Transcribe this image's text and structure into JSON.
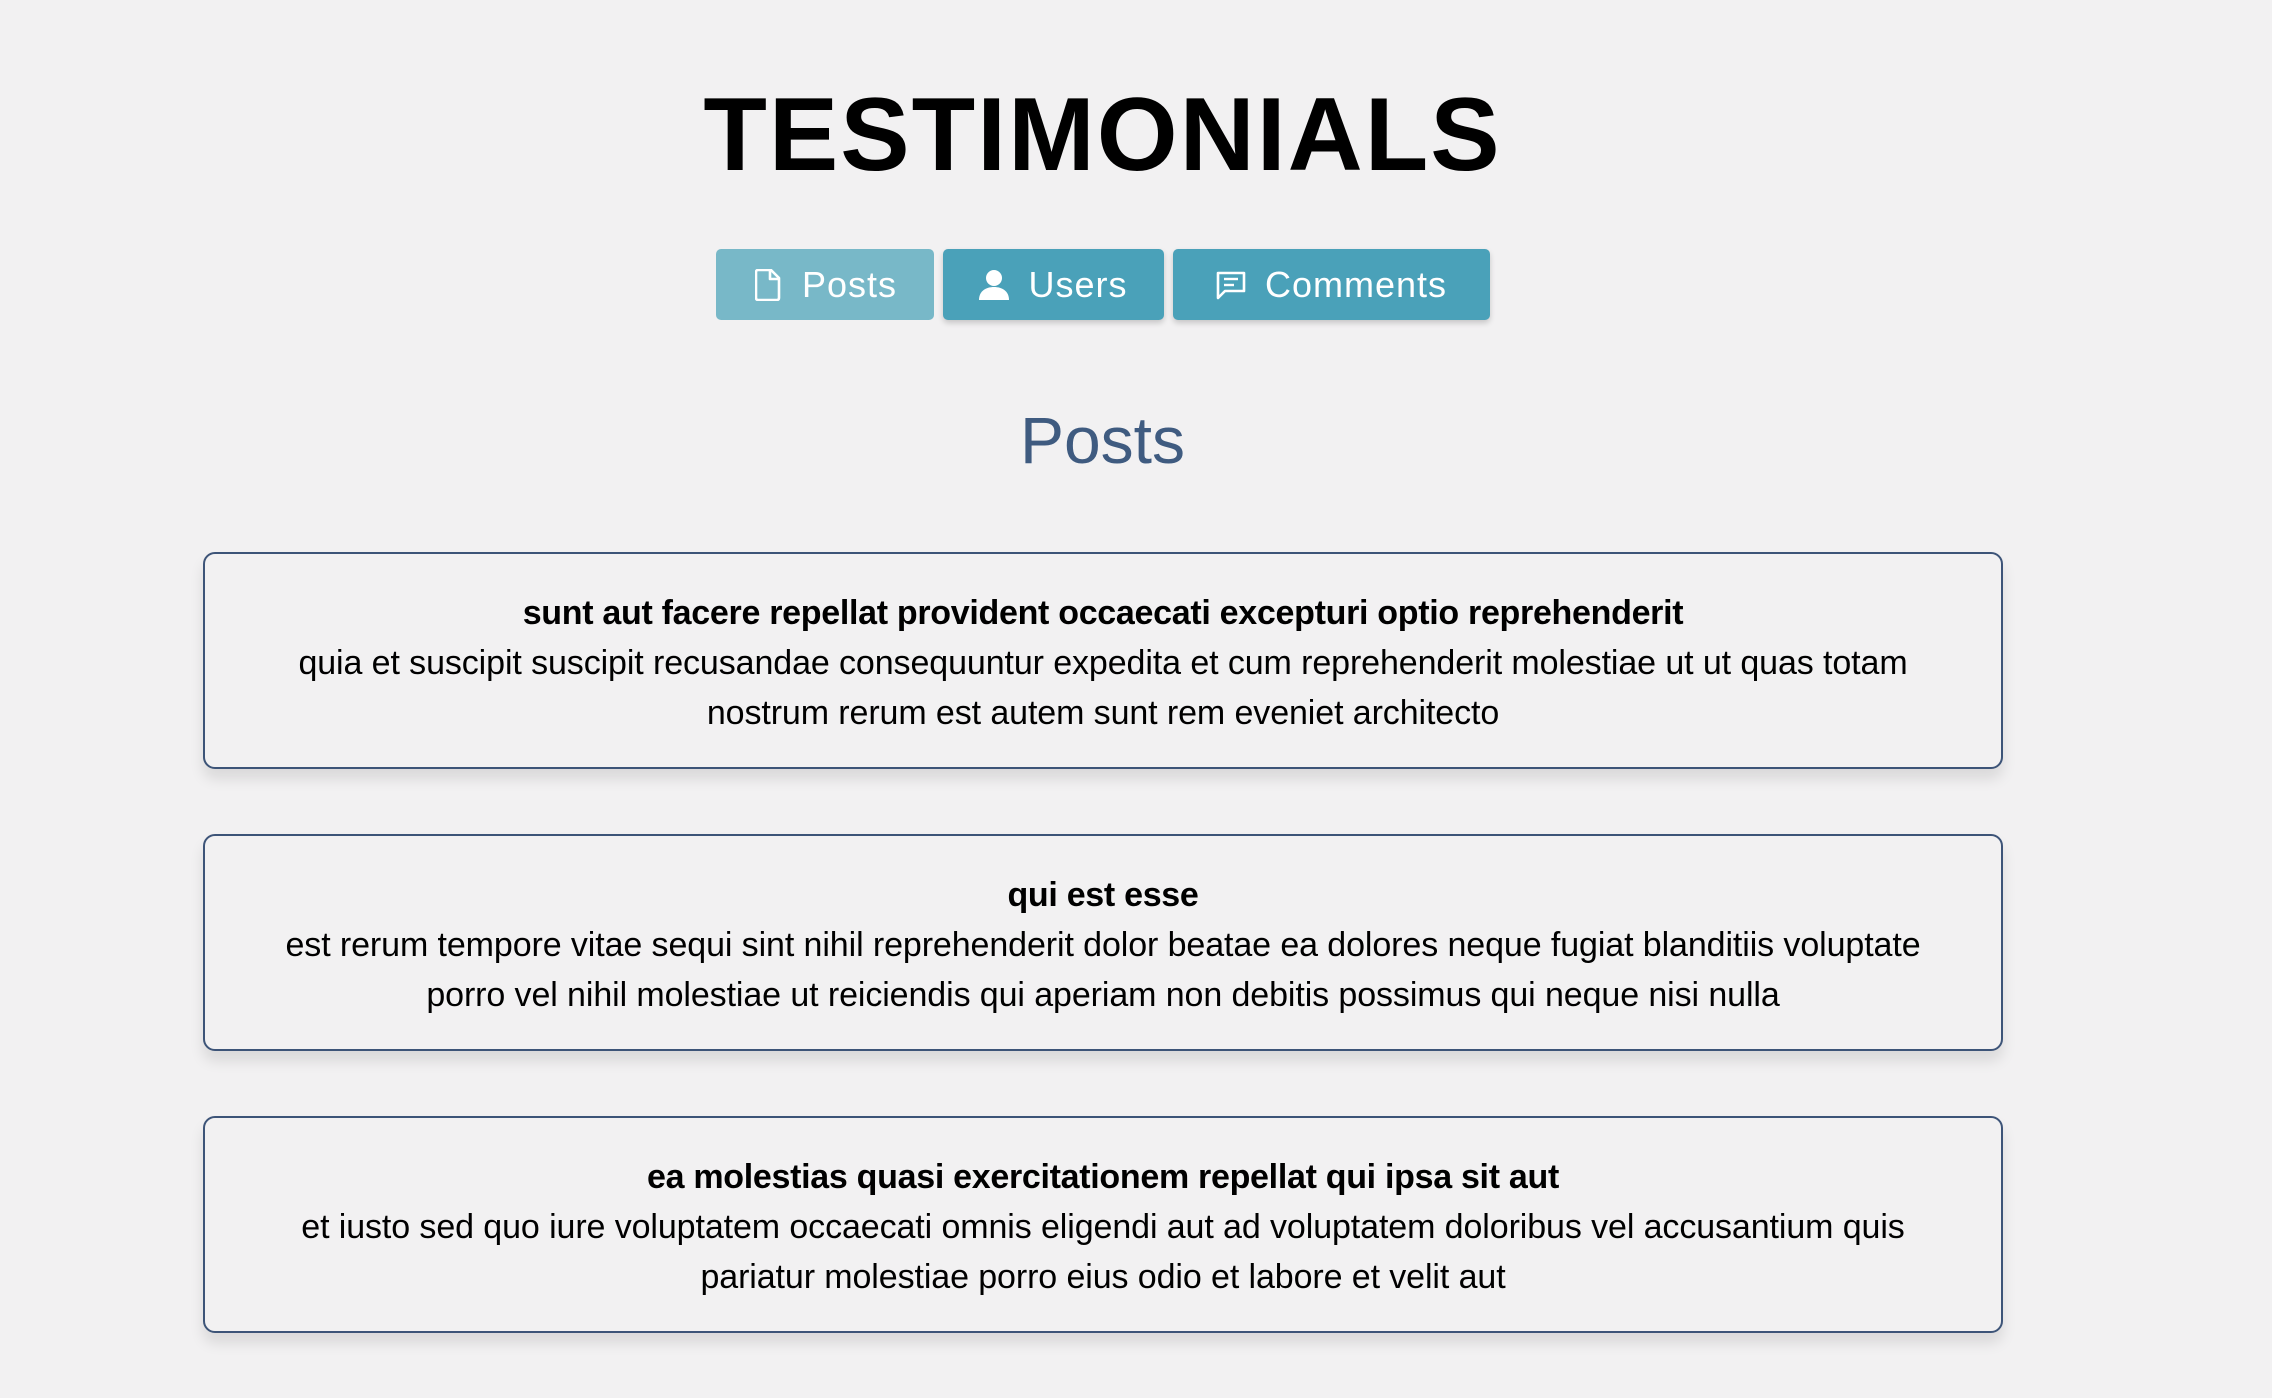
{
  "page": {
    "title": "TESTIMONIALS"
  },
  "tabs": [
    {
      "label": "Posts",
      "icon": "document-icon",
      "active": true
    },
    {
      "label": "Users",
      "icon": "user-icon",
      "active": false
    },
    {
      "label": "Comments",
      "icon": "comment-icon",
      "active": false
    }
  ],
  "section": {
    "title": "Posts"
  },
  "posts": [
    {
      "title": "sunt aut facere repellat provident occaecati excepturi optio reprehenderit",
      "body": "quia et suscipit suscipit recusandae consequuntur expedita et cum reprehenderit molestiae ut ut quas totam nostrum rerum est autem sunt rem eveniet architecto"
    },
    {
      "title": "qui est esse",
      "body": "est rerum tempore vitae sequi sint nihil reprehenderit dolor beatae ea dolores neque fugiat blanditiis voluptate porro vel nihil molestiae ut reiciendis qui aperiam non debitis possimus qui neque nisi nulla"
    },
    {
      "title": "ea molestias quasi exercitationem repellat qui ipsa sit aut",
      "body": "et iusto sed quo iure voluptatem occaecati omnis eligendi aut ad voluptatem doloribus vel accusantium quis pariatur molestiae porro eius odio et labore et velit aut"
    }
  ],
  "colors": {
    "background": "#f2f1f2",
    "tab": "#4aa1b9",
    "tab_active": "#78b8c8",
    "section_title": "#3f5b80",
    "card_border": "#3d5478"
  }
}
